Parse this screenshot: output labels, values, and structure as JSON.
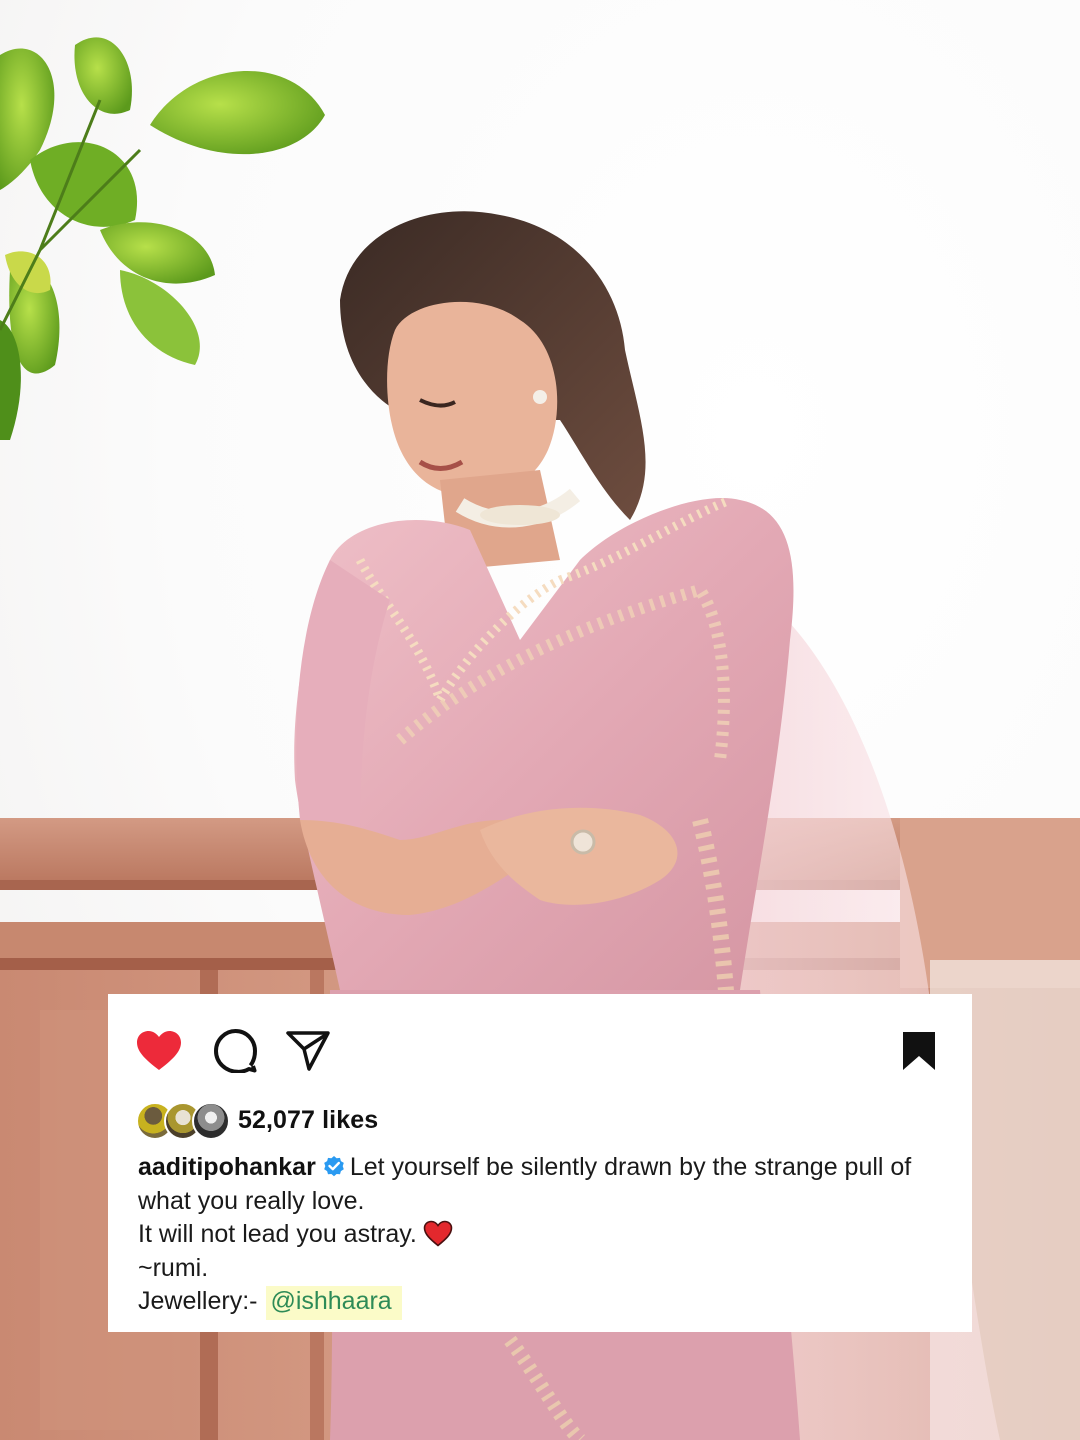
{
  "post": {
    "likes_count": "52,077",
    "likes_suffix": "likes",
    "username": "aaditipohankar",
    "caption_line1": "Let yourself be silently drawn by the strange pull of",
    "caption_line2": "what you really love.",
    "caption_line3": "It will not lead you astray.",
    "caption_line4": "~rumi.",
    "caption_line5_prefix": "Jewellery:-",
    "mention": "@ishhaara"
  },
  "actions": {
    "like_icon": "heart-filled-icon",
    "comment_icon": "speech-bubble-icon",
    "share_icon": "paper-plane-icon",
    "save_icon": "bookmark-filled-icon"
  },
  "colors": {
    "like_red": "#ed2a3a",
    "verified_blue": "#2a9af1",
    "mention_green": "#2e8b57",
    "mention_highlight": "#fbfbc8",
    "saree_pink": "#e3a8b4"
  }
}
